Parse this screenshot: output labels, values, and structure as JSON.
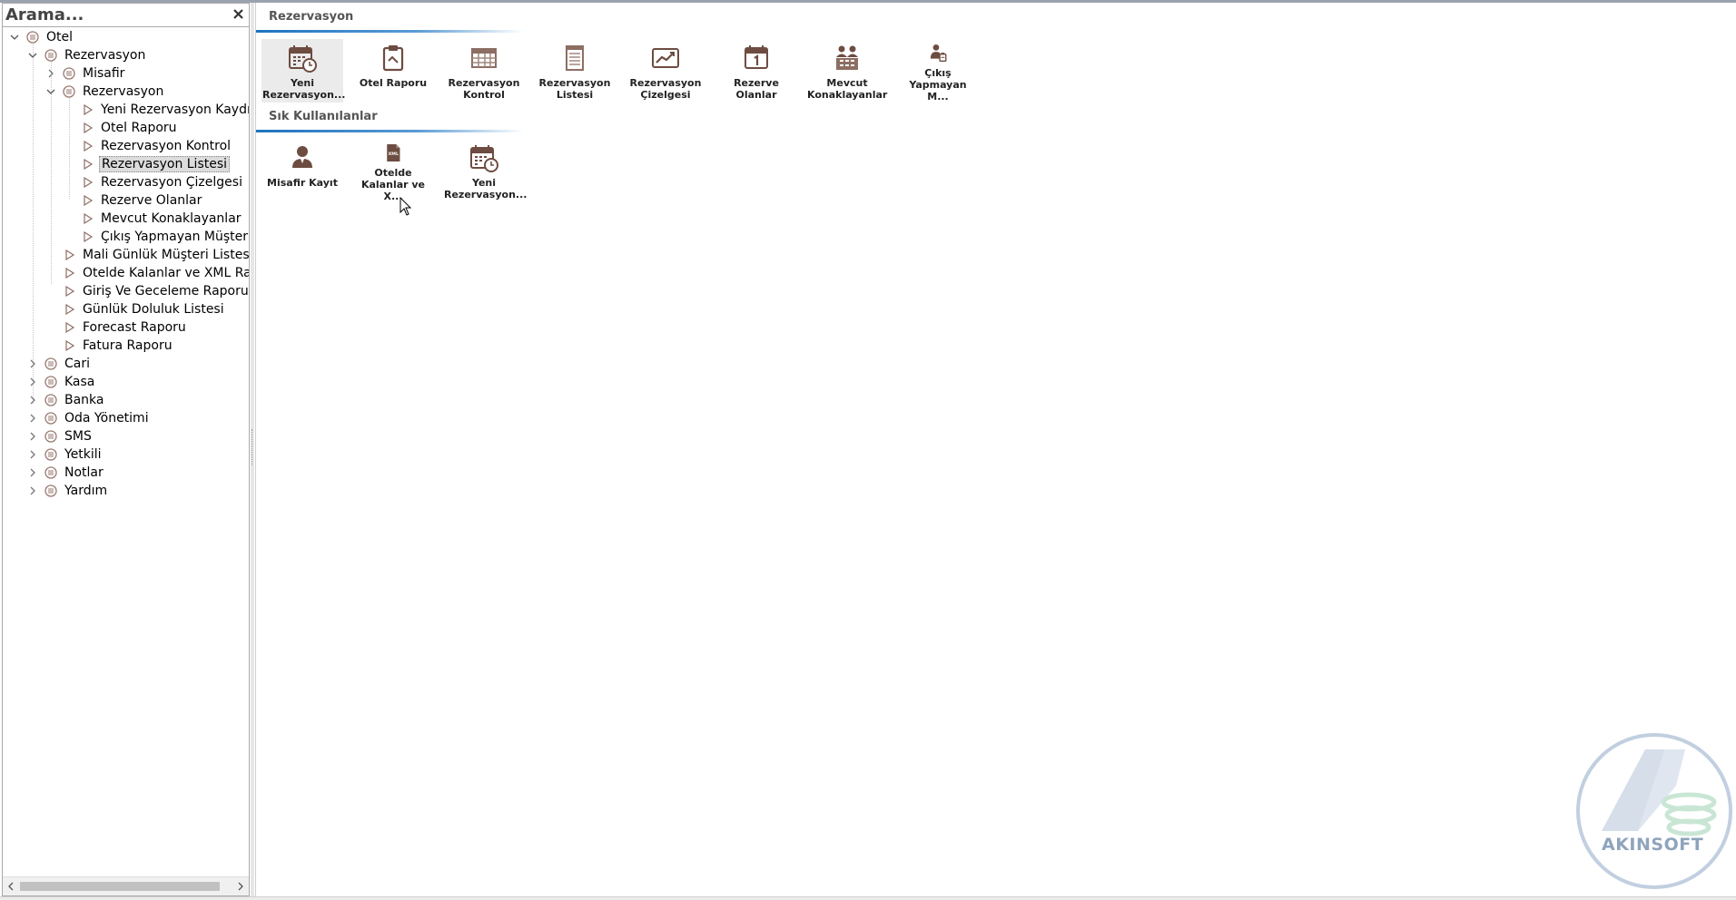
{
  "search": {
    "placeholder": "Arama..."
  },
  "tree": {
    "items": [
      {
        "label": "Otel"
      },
      {
        "label": "Rezervasyon"
      },
      {
        "label": "Misafir"
      },
      {
        "label": "Rezervasyon"
      },
      {
        "label": "Yeni Rezervasyon Kaydı"
      },
      {
        "label": "Otel Raporu"
      },
      {
        "label": "Rezervasyon Kontrol"
      },
      {
        "label": "Rezervasyon Listesi"
      },
      {
        "label": "Rezervasyon Çizelgesi"
      },
      {
        "label": "Rezerve Olanlar"
      },
      {
        "label": "Mevcut Konaklayanlar"
      },
      {
        "label": "Çıkış Yapmayan Müşteriler"
      },
      {
        "label": "Mali Günlük Müşteri Listesi"
      },
      {
        "label": "Otelde Kalanlar ve XML Raporu"
      },
      {
        "label": "Giriş Ve Geceleme Raporu"
      },
      {
        "label": "Günlük Doluluk Listesi"
      },
      {
        "label": "Forecast Raporu"
      },
      {
        "label": "Fatura Raporu"
      },
      {
        "label": "Cari"
      },
      {
        "label": "Kasa"
      },
      {
        "label": "Banka"
      },
      {
        "label": "Oda Yönetimi"
      },
      {
        "label": "SMS"
      },
      {
        "label": "Yetkili"
      },
      {
        "label": "Notlar"
      },
      {
        "label": "Yardım"
      }
    ]
  },
  "groups": [
    {
      "title": "Rezervasyon",
      "tiles": [
        {
          "line1": "Yeni",
          "line2": "Rezervasyon...",
          "icon": "calendar-clock-icon"
        },
        {
          "line1": "Otel Raporu",
          "line2": "",
          "icon": "clipboard-icon"
        },
        {
          "line1": "Rezervasyon",
          "line2": "Kontrol",
          "icon": "grid-calendar-icon"
        },
        {
          "line1": "Rezervasyon",
          "line2": "Listesi",
          "icon": "list-icon"
        },
        {
          "line1": "Rezervasyon",
          "line2": "Çizelgesi",
          "icon": "chart-icon"
        },
        {
          "line1": "Rezerve",
          "line2": "Olanlar",
          "icon": "calendar-day-icon"
        },
        {
          "line1": "Mevcut",
          "line2": "Konaklayanlar",
          "icon": "people-icon"
        },
        {
          "line1": "Çıkış",
          "line2": "Yapmayan M...",
          "icon": "person-luggage-icon"
        }
      ]
    },
    {
      "title": "Sık Kullanılanlar",
      "tiles": [
        {
          "line1": "Misafir Kayıt",
          "line2": "",
          "icon": "person-icon"
        },
        {
          "line1": "Otelde",
          "line2": "Kalanlar ve X...",
          "icon": "xml-file-icon",
          "badge": "XML"
        },
        {
          "line1": "Yeni",
          "line2": "Rezervasyon...",
          "icon": "calendar-clock-icon"
        }
      ]
    }
  ],
  "watermark": {
    "text": "AKINSOFT"
  },
  "colors": {
    "icon": "#6d4c41",
    "accent": "#1e73be"
  }
}
